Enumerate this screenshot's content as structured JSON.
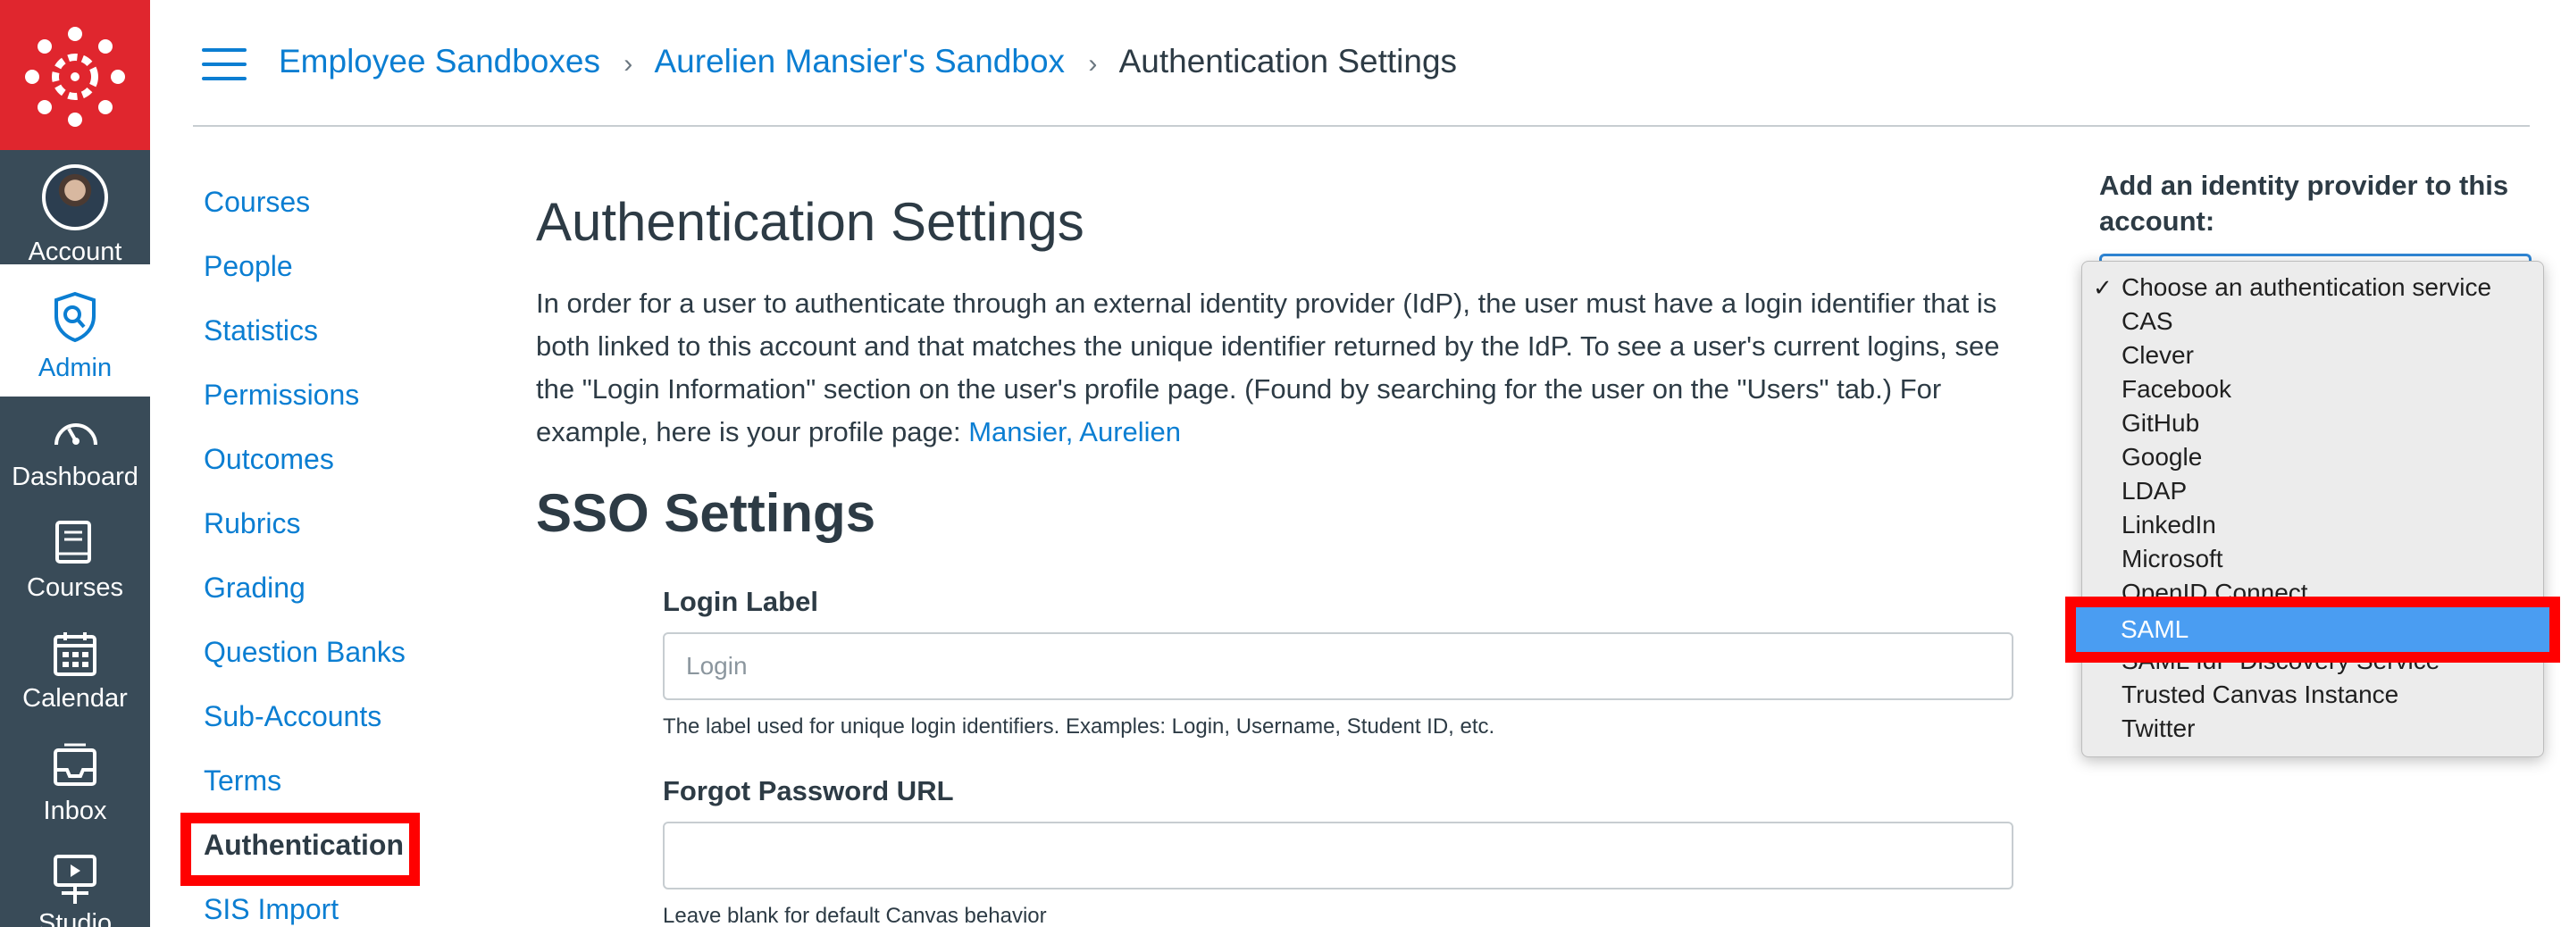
{
  "global_nav": {
    "items": [
      {
        "label": "Account",
        "icon": "avatar"
      },
      {
        "label": "Admin",
        "icon": "shield-icon",
        "active": true
      },
      {
        "label": "Dashboard",
        "icon": "speedometer-icon"
      },
      {
        "label": "Courses",
        "icon": "book-icon"
      },
      {
        "label": "Calendar",
        "icon": "calendar-icon"
      },
      {
        "label": "Inbox",
        "icon": "inbox-icon"
      },
      {
        "label": "Studio",
        "icon": "studio-icon"
      }
    ],
    "brand_color": "#e0262e",
    "rail_color": "#394b58",
    "active_color": "#0b7ed2"
  },
  "breadcrumb": {
    "items": [
      "Employee Sandboxes",
      "Aurelien Mansier's Sandbox"
    ],
    "current": "Authentication Settings"
  },
  "section_nav": {
    "items": [
      "Courses",
      "People",
      "Statistics",
      "Permissions",
      "Outcomes",
      "Rubrics",
      "Grading",
      "Question Banks",
      "Sub-Accounts",
      "Terms",
      "Authentication",
      "SIS Import"
    ],
    "active": "Authentication"
  },
  "main": {
    "title": "Authentication Settings",
    "intro": "In order for a user to authenticate through an external identity provider (IdP), the user must have a login identifier that is both linked to this account and that matches the unique identifier returned by the IdP. To see a user's current logins, see the \"Login Information\" section on the user's profile page. (Found by searching for the user on the \"Users\" tab.) For example, here is your profile page:",
    "profile_link": "Mansier, Aurelien",
    "sso_title": "SSO Settings",
    "login_label": {
      "label": "Login Label",
      "placeholder": "Login",
      "hint": "The label used for unique login identifiers. Examples: Login, Username, Student ID, etc."
    },
    "forgot_password": {
      "label": "Forgot Password URL",
      "value": "",
      "hint": "Leave blank for default Canvas behavior"
    }
  },
  "sidebar": {
    "heading": "Add an identity provider to this account:",
    "options": [
      "Choose an authentication service",
      "CAS",
      "Clever",
      "Facebook",
      "GitHub",
      "Google",
      "LDAP",
      "LinkedIn",
      "Microsoft",
      "OpenID Connect",
      "SAML",
      "SAML IdP Discovery Service",
      "Trusted Canvas Instance",
      "Twitter"
    ],
    "checked_option": "Choose an authentication service",
    "highlighted_option": "SAML",
    "highlight_color": "#4a9df2",
    "annotation_color": "#ff0000"
  }
}
